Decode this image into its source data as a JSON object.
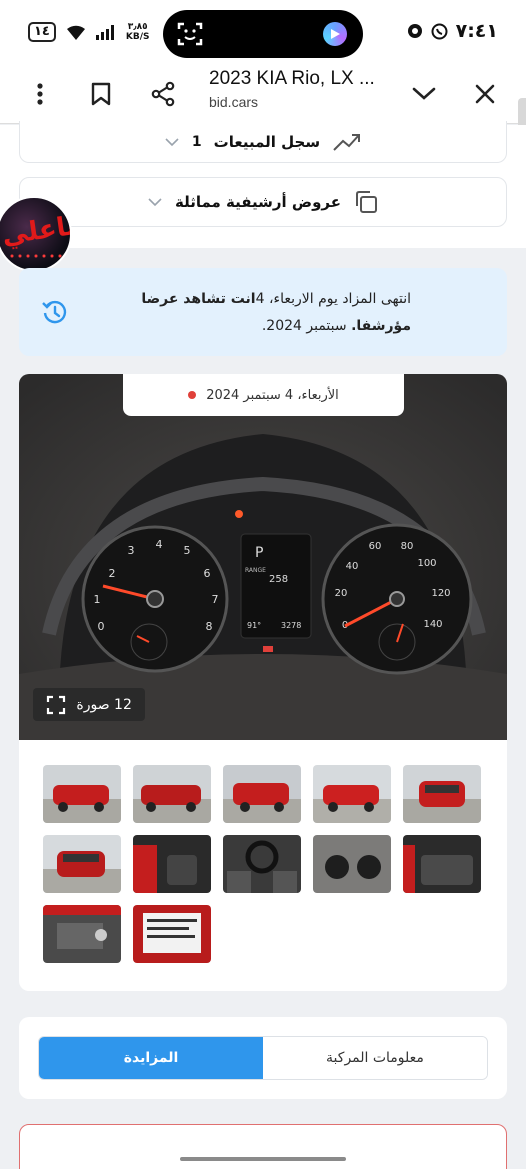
{
  "status_bar": {
    "time": "٧:٤١",
    "battery": "١٤",
    "net_speed_value": "٣٫٨٥",
    "net_speed_unit": "KB/S"
  },
  "browser": {
    "page_title": "2023 KIA Rio, LX ...",
    "domain": "bid.cars"
  },
  "accordion": {
    "sales_history_label": "سجل المبيعات",
    "sales_history_count": "1",
    "similar_offers_label": "عروض أرشيفية مماثلة"
  },
  "avatar_overlay_text": "ياعلي",
  "notice": {
    "text_before": "انتهى المزاد يوم الاربعاء، 4",
    "text_bold": "انت تشاهد عرضا مؤرشفا.",
    "text_after": " سبتمبر 2024."
  },
  "gallery": {
    "date_label": "الأربعاء، 4 سبتمبر 2024",
    "photo_count_label": "12 صورة",
    "dash_labels": {
      "gear": "P",
      "range_label": "RANGE",
      "range_value": "258",
      "odometer": "3278",
      "temp": "91°"
    },
    "thumbnails": [
      "car-front-left",
      "car-rear-damage",
      "car-rear-right",
      "car-front-right",
      "car-front",
      "car-rear",
      "interior-door",
      "dashboard",
      "instrument-cluster",
      "rear-seats",
      "engine-bay",
      "vin-label"
    ]
  },
  "tabs": [
    {
      "label": "المزايدة",
      "active": true
    },
    {
      "label": "معلومات المركبة",
      "active": false
    }
  ],
  "colors": {
    "accent": "#2f96ec",
    "notice_bg": "#e3f1fd",
    "status_dot": "#e0403a"
  }
}
